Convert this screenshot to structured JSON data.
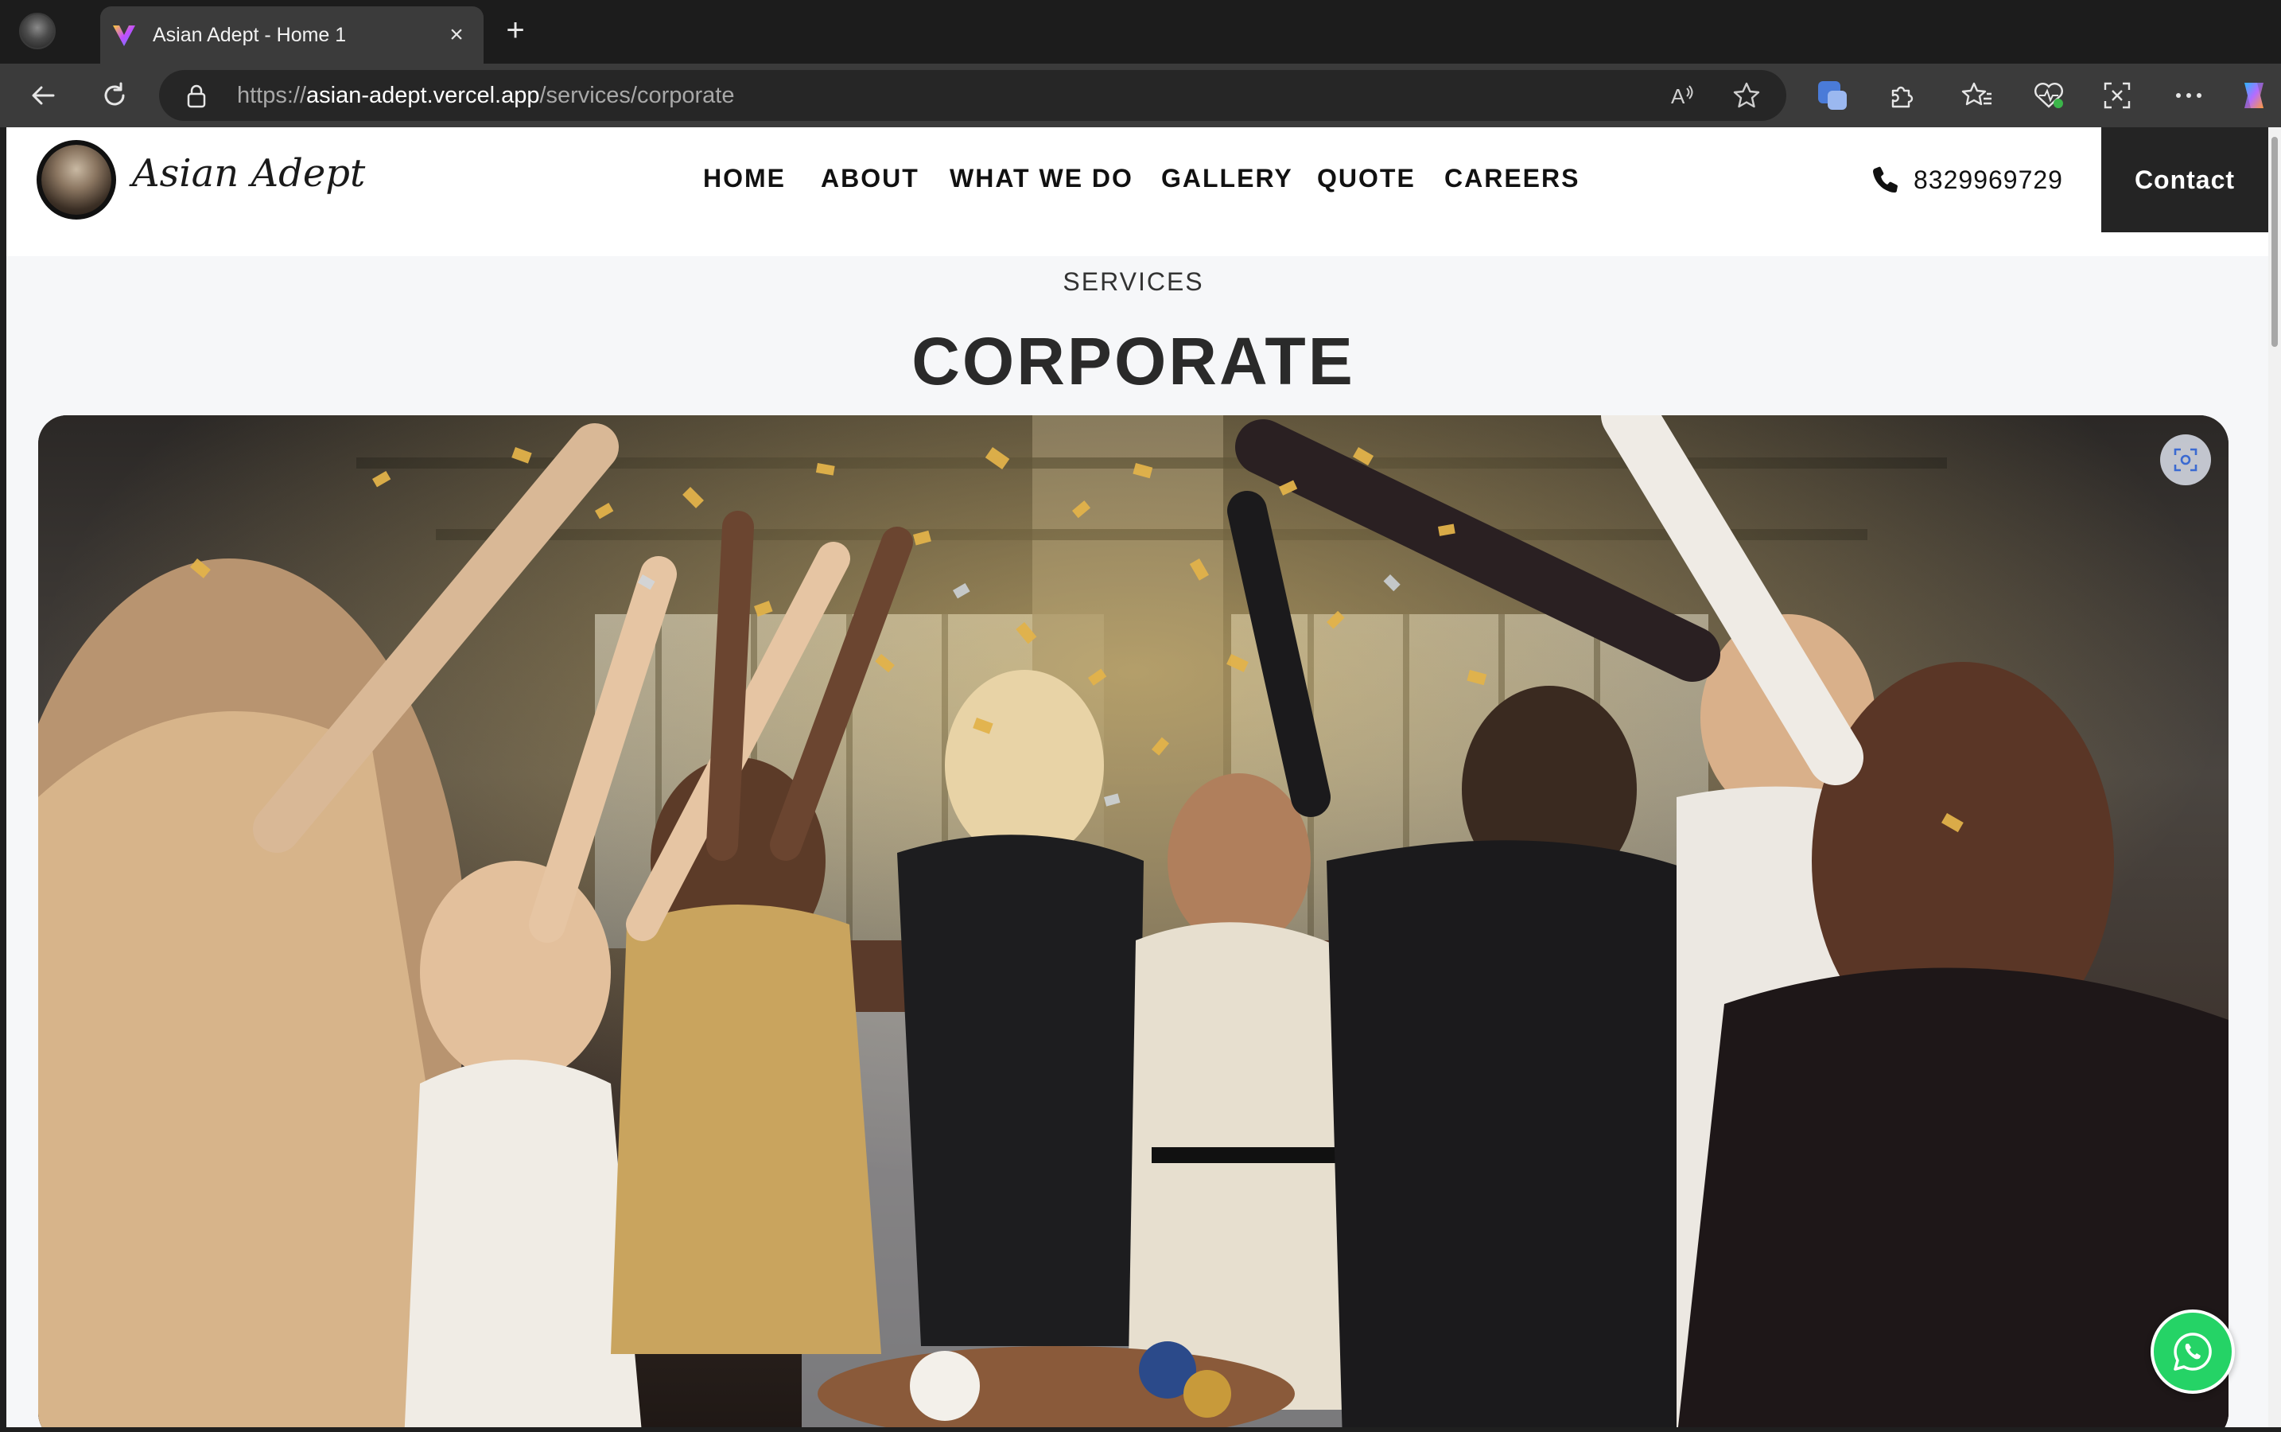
{
  "browser": {
    "tab_title": "Asian Adept - Home 1",
    "url_scheme": "https://",
    "url_host": "asian-adept.vercel.app",
    "url_path": "/services/corporate"
  },
  "site": {
    "brand": "Asian Adept",
    "nav": [
      "HOME",
      "ABOUT",
      "WHAT WE DO",
      "GALLERY",
      "QUOTE",
      "CAREERS"
    ],
    "phone": "8329969729",
    "contact_label": "Contact"
  },
  "page": {
    "kicker": "SERVICES",
    "title": "CORPORATE"
  },
  "colors": {
    "header_bg": "#ffffff",
    "page_bg": "#f6f7f9",
    "contact_bg": "#242424",
    "whatsapp": "#25d366"
  },
  "icons": {
    "back": "arrow-left-icon",
    "reload": "refresh-icon",
    "lock": "lock-icon",
    "read_aloud": "read-aloud-icon",
    "favorite": "star-icon",
    "extensions": "puzzle-icon",
    "favorites_bar": "favorites-icon",
    "health": "browser-essentials-icon",
    "screenshot": "screenshot-icon",
    "more": "more-icon",
    "copilot": "copilot-icon",
    "phone": "phone-icon",
    "whatsapp": "whatsapp-icon",
    "visual_search": "visual-search-icon"
  }
}
